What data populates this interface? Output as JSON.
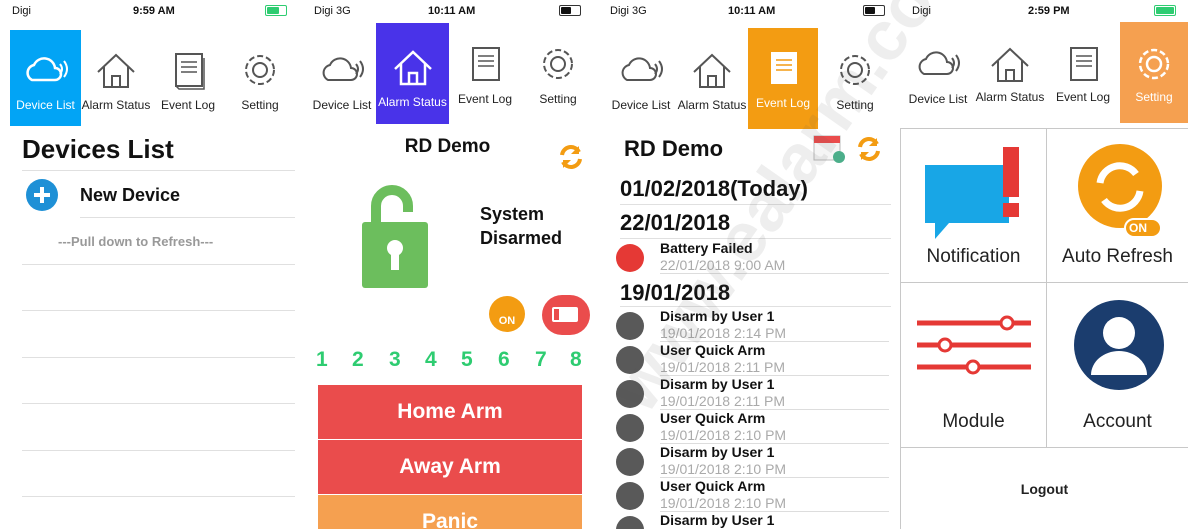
{
  "screens": [
    {
      "status": {
        "carrier": "Digi",
        "time": "9:59 AM"
      },
      "tabs": [
        "Device List",
        "Alarm Status",
        "Event Log",
        "Setting"
      ],
      "title": "Devices List",
      "new_device": "New Device",
      "hint": "---Pull down to Refresh---"
    },
    {
      "status": {
        "carrier": "Digi  3G",
        "time": "10:11 AM"
      },
      "tabs": [
        "Device List",
        "Alarm Status",
        "Event Log",
        "Setting"
      ],
      "site": "RD Demo",
      "system_status_1": "System",
      "system_status_2": "Disarmed",
      "on_badge": "ON",
      "zones": [
        "1",
        "2",
        "3",
        "4",
        "5",
        "6",
        "7",
        "8"
      ],
      "buttons": [
        "Home Arm",
        "Away Arm",
        "Panic"
      ]
    },
    {
      "status": {
        "carrier": "Digi  3G",
        "time": "10:11 AM"
      },
      "tabs": [
        "Device List",
        "Alarm Status",
        "Event Log",
        "Setting"
      ],
      "site": "RD Demo",
      "date_today": "01/02/2018(Today)",
      "groups": [
        {
          "date": "22/01/2018",
          "events": [
            {
              "title": "Battery Failed",
              "time": "22/01/2018 9:00 AM",
              "type": "battery"
            }
          ]
        },
        {
          "date": "19/01/2018",
          "events": [
            {
              "title": "Disarm by User 1",
              "time": "19/01/2018 2:14 PM",
              "type": "lock"
            },
            {
              "title": "User Quick Arm",
              "time": "19/01/2018 2:11 PM",
              "type": "lock"
            },
            {
              "title": "Disarm by User 1",
              "time": "19/01/2018 2:11 PM",
              "type": "lock"
            },
            {
              "title": "User Quick Arm",
              "time": "19/01/2018 2:10 PM",
              "type": "lock"
            },
            {
              "title": "Disarm by User 1",
              "time": "19/01/2018 2:10 PM",
              "type": "lock"
            },
            {
              "title": "User Quick Arm",
              "time": "19/01/2018 2:10 PM",
              "type": "lock"
            },
            {
              "title": "Disarm by User 1",
              "time": "",
              "type": "lock"
            }
          ]
        }
      ]
    },
    {
      "status": {
        "carrier": "Digi",
        "time": "2:59 PM"
      },
      "tabs": [
        "Device List",
        "Alarm Status",
        "Event Log",
        "Setting"
      ],
      "cells": [
        "Notification",
        "Auto Refresh",
        "Module",
        "Account"
      ],
      "on_badge": "ON",
      "logout": "Logout"
    }
  ],
  "colors": {
    "blue": "#02a4f5",
    "purple": "#4933e9",
    "orange": "#f39c12",
    "green": "#6cbe5d",
    "red": "#ea4c4c",
    "navy": "#1b3d6e"
  },
  "watermark": "www.ealarm.com.my"
}
